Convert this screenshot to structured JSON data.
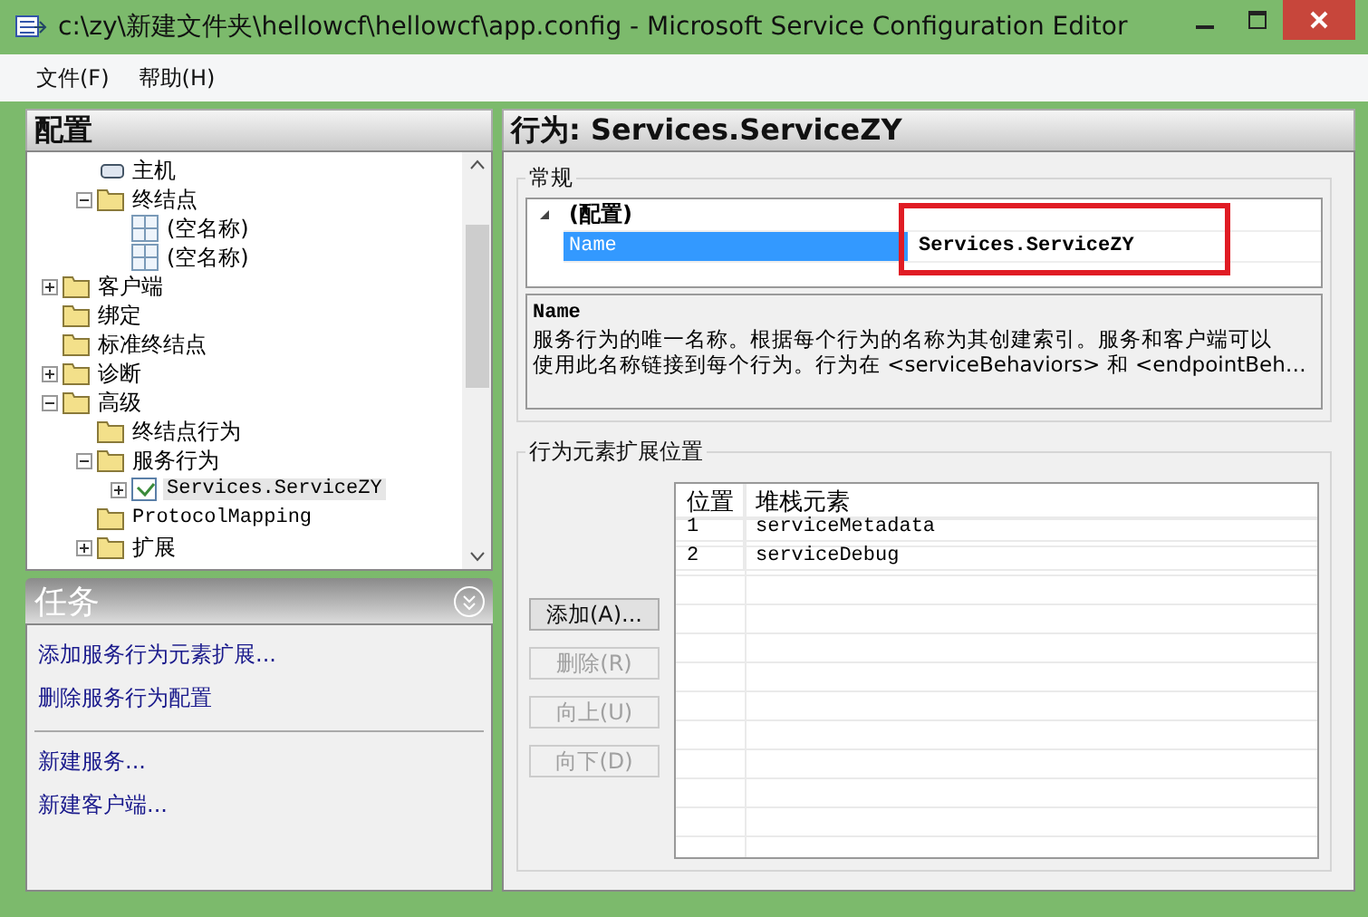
{
  "window": {
    "title": "c:\\zy\\新建文件夹\\hellowcf\\hellowcf\\app.config - Microsoft Service Configuration Editor"
  },
  "menu": [
    "文件(F)",
    "帮助(H)"
  ],
  "config_panel": {
    "title": "配置",
    "tree": [
      {
        "children": [
          {
            "label": "主机",
            "kind": "host",
            "selected": false
          },
          {
            "label": "终结点",
            "kind": "folder",
            "expanded": true,
            "selected": false,
            "children": [
              {
                "label": "(空名称)",
                "kind": "endpoint",
                "selected": false
              },
              {
                "label": "(空名称)",
                "kind": "endpoint",
                "selected": false
              }
            ]
          }
        ]
      },
      {
        "label": "客户端",
        "kind": "folder",
        "expanded": false,
        "selected": false
      },
      {
        "label": "绑定",
        "kind": "folder",
        "selected": false
      },
      {
        "label": "标准终结点",
        "kind": "folder",
        "selected": false
      },
      {
        "label": "诊断",
        "kind": "folder",
        "expanded": false,
        "selected": false
      },
      {
        "label": "高级",
        "kind": "folder",
        "expanded": true,
        "selected": false,
        "children": [
          {
            "label": "终结点行为",
            "kind": "folder",
            "selected": false
          },
          {
            "label": "服务行为",
            "kind": "folder",
            "expanded": true,
            "selected": false,
            "children": [
              {
                "label": "Services.ServiceZY",
                "kind": "behavior",
                "expanded": false,
                "selected": true
              }
            ]
          },
          {
            "label": "ProtocolMapping",
            "kind": "folder",
            "selected": false
          },
          {
            "label": "扩展",
            "kind": "folder",
            "expanded": false,
            "selected": false
          }
        ]
      }
    ]
  },
  "tasks_panel": {
    "title": "任务",
    "groups": [
      [
        "添加服务行为元素扩展...",
        "删除服务行为配置"
      ],
      [
        "新建服务...",
        "新建客户端..."
      ]
    ]
  },
  "detail_panel": {
    "title": "行为: Services.ServiceZY",
    "general": {
      "title": "常规",
      "category": {
        "label": "(配置)",
        "expanded": true
      },
      "properties": [
        {
          "name": "Name",
          "value": "Services.ServiceZY",
          "selected": true
        }
      ],
      "description": {
        "title": "Name",
        "lines": [
          "服务行为的唯一名称。根据每个行为的名称为其创建索引。服务和客户端可以",
          "使用此名称链接到每个行为。行为在  <serviceBehaviors> 和 <endpointBeh…"
        ]
      }
    },
    "extensions": {
      "title": "行为元素扩展位置",
      "buttons": [
        {
          "label": "添加(A)...",
          "disabled": false
        },
        {
          "label": "删除(R)",
          "disabled": true
        },
        {
          "label": "向上(U)",
          "disabled": true
        },
        {
          "label": "向下(D)",
          "disabled": true
        }
      ],
      "columns": [
        "位置",
        "堆栈元素"
      ],
      "rows": [
        [
          "1",
          "serviceMetadata"
        ],
        [
          "2",
          "serviceDebug"
        ]
      ]
    }
  }
}
